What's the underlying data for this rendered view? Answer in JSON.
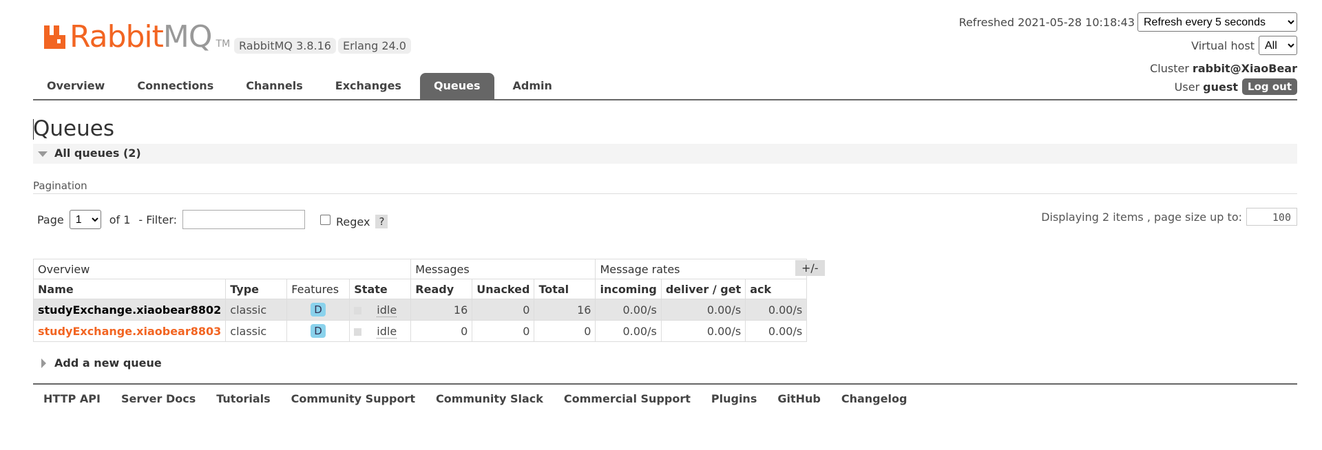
{
  "header": {
    "logo_text_1": "RabbitMQ",
    "logo_rabbit": "Rabbit",
    "logo_mq": "MQ",
    "logo_tm": "TM",
    "rabbitmq_version": "RabbitMQ 3.8.16",
    "erlang_version": "Erlang 24.0",
    "refreshed_label": "Refreshed 2021-05-28 10:18:43",
    "refresh_option": "Refresh every 5 seconds",
    "vhost_label": "Virtual host",
    "vhost_option": "All",
    "cluster_label": "Cluster",
    "cluster_value": "rabbit@XiaoBear",
    "user_label": "User",
    "user_value": "guest",
    "logout_label": "Log out"
  },
  "tabs": [
    {
      "label": "Overview"
    },
    {
      "label": "Connections"
    },
    {
      "label": "Channels"
    },
    {
      "label": "Exchanges"
    },
    {
      "label": "Queues",
      "active": true
    },
    {
      "label": "Admin"
    }
  ],
  "main": {
    "title": "Queues",
    "section_title": "All queues (2)",
    "pagination_label": "Pagination",
    "page_label": "Page",
    "page_value": "1",
    "of_label": "of 1",
    "filter_label": "- Filter:",
    "regex_label": "Regex",
    "help_label": "?",
    "display_text": "Displaying 2 items , page size up to:",
    "page_size": "100"
  },
  "table": {
    "group_headers": [
      "Overview",
      "Messages",
      "Message rates"
    ],
    "columns": [
      "Name",
      "Type",
      "Features",
      "State",
      "Ready",
      "Unacked",
      "Total",
      "incoming",
      "deliver / get",
      "ack"
    ],
    "plusminus": "+/-",
    "rows": [
      {
        "name": "studyExchange.xiaobear8802",
        "type": "classic",
        "feature": "D",
        "state": "idle",
        "ready": "16",
        "unacked": "0",
        "total": "16",
        "incoming": "0.00/s",
        "deliver_get": "0.00/s",
        "ack": "0.00/s"
      },
      {
        "name": "studyExchange.xiaobear8803",
        "type": "classic",
        "feature": "D",
        "state": "idle",
        "ready": "0",
        "unacked": "0",
        "total": "0",
        "incoming": "0.00/s",
        "deliver_get": "0.00/s",
        "ack": "0.00/s"
      }
    ]
  },
  "add_queue_label": "Add a new queue",
  "footer": [
    "HTTP API",
    "Server Docs",
    "Tutorials",
    "Community Support",
    "Community Slack",
    "Commercial Support",
    "Plugins",
    "GitHub",
    "Changelog"
  ],
  "colors": {
    "brand_orange": "#f26522",
    "tab_active": "#666666",
    "feature_badge": "#8ad2ec"
  },
  "icons": {
    "logo": "rabbitmq-logo-icon",
    "section_toggle": "triangle-down-icon",
    "add_toggle": "triangle-right-icon"
  }
}
